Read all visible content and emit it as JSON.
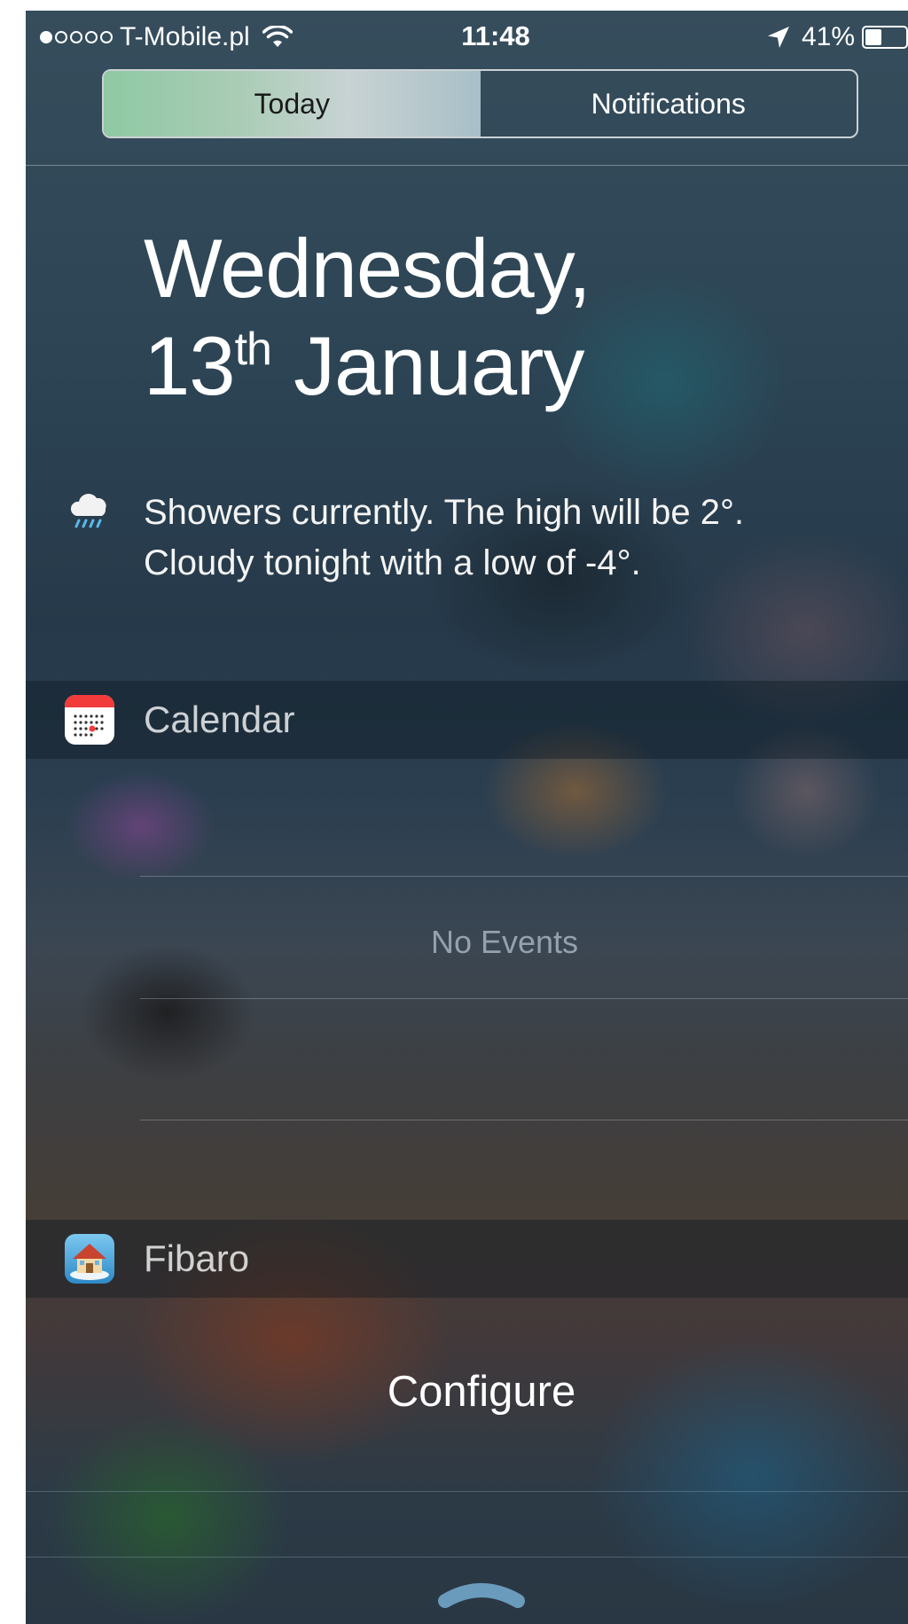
{
  "status_bar": {
    "signal_strength": "1 of 5",
    "carrier": "T-Mobile.pl",
    "time": "11:48",
    "battery_percent": "41%",
    "battery_level": 0.41,
    "icons": [
      "wifi-icon",
      "location-arrow-icon",
      "battery-icon"
    ]
  },
  "segmented_control": {
    "tabs": [
      {
        "label": "Today",
        "selected": true
      },
      {
        "label": "Notifications",
        "selected": false
      }
    ]
  },
  "today": {
    "date": {
      "weekday": "Wednesday,",
      "day": "13",
      "ordinal_suffix": "th",
      "month": "January"
    },
    "weather": {
      "icon": "cloud-rain-icon",
      "line1": "Showers currently. The high will be 2°.",
      "line2": "Cloudy tonight with a low of -4°."
    }
  },
  "widgets": {
    "calendar": {
      "title": "Calendar",
      "icon": "calendar-app-icon",
      "empty_text": "No Events"
    },
    "fibaro": {
      "title": "Fibaro",
      "icon": "fibaro-app-icon",
      "action_label": "Configure"
    }
  },
  "colors": {
    "active_tab_gradient_start": "#8fc9a3",
    "active_tab_gradient_end": "#a8bfc7",
    "calendar_icon_red": "#f23b3b"
  }
}
